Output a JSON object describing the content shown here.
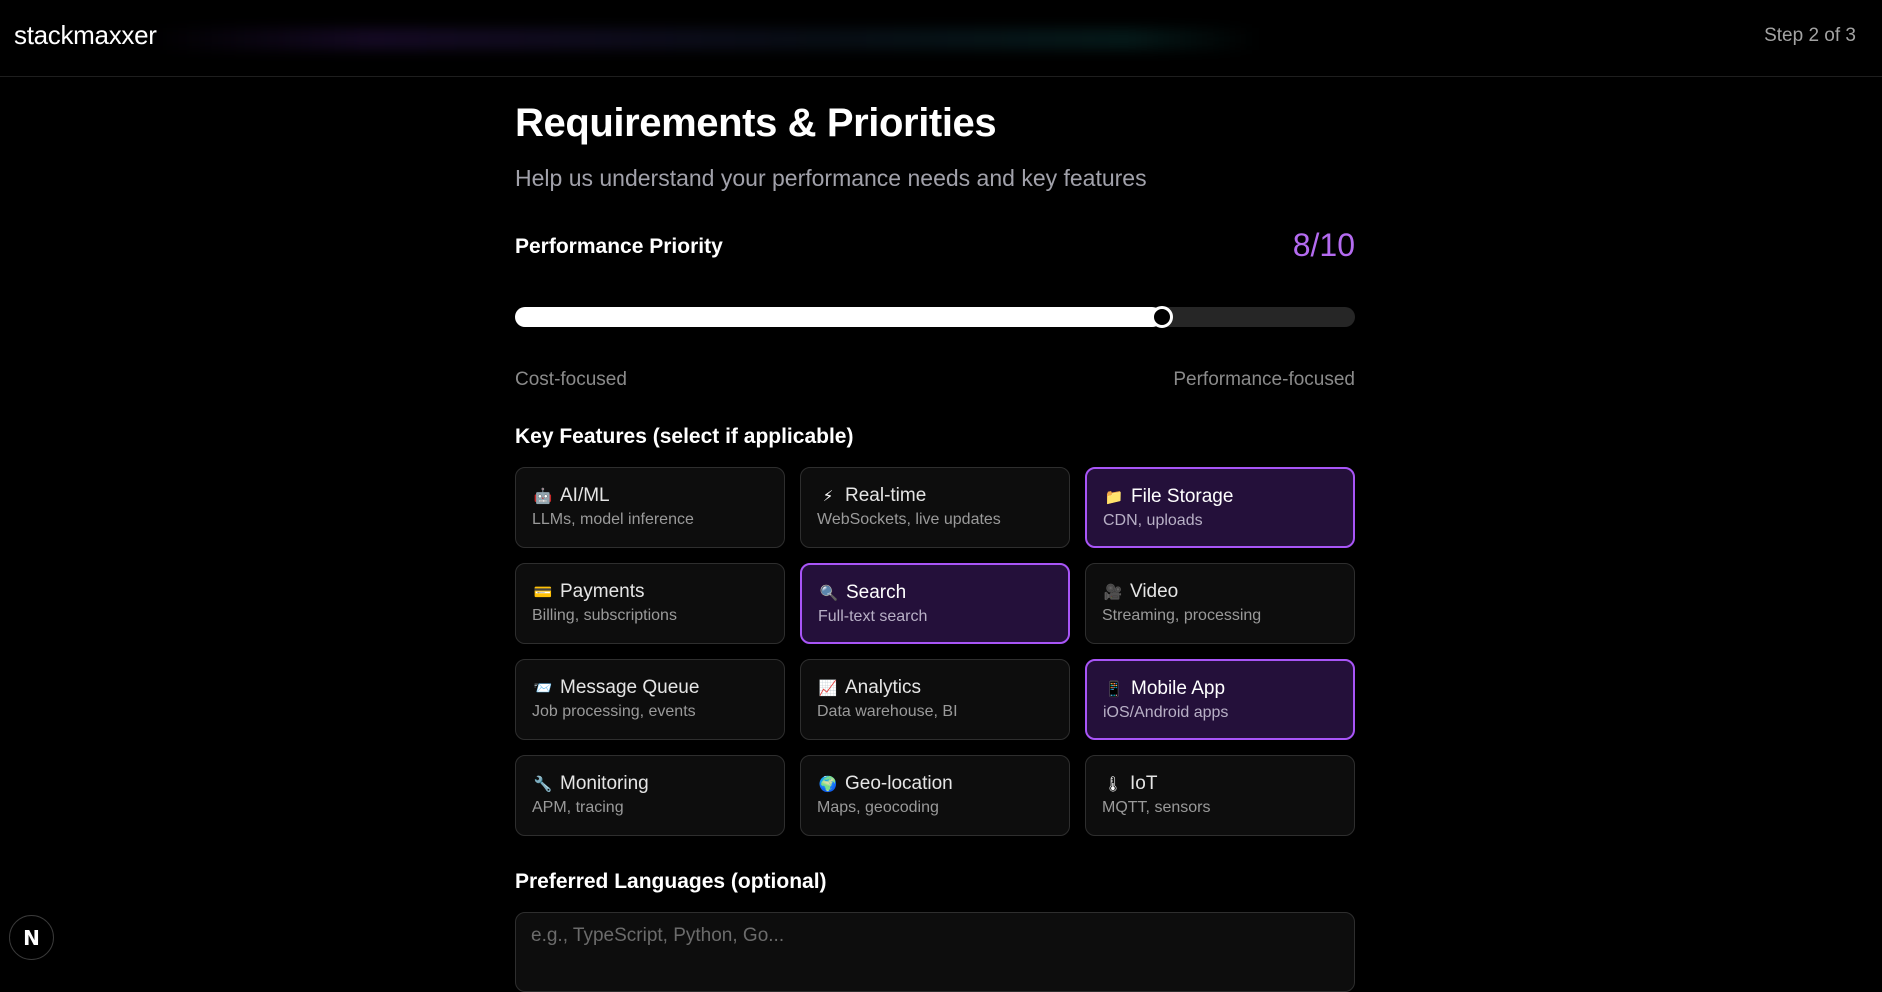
{
  "header": {
    "brand": "stackmaxxer",
    "step": "Step 2 of 3"
  },
  "page": {
    "title": "Requirements & Priorities",
    "subtitle": "Help us understand your performance needs and key features"
  },
  "performance": {
    "label": "Performance Priority",
    "value_text": "8/10",
    "value": 8,
    "max": 10,
    "fill_fraction": 0.77,
    "min_label": "Cost-focused",
    "max_label": "Performance-focused"
  },
  "features": {
    "label": "Key Features (select if applicable)",
    "items": [
      {
        "icon": "robot-icon",
        "glyph": "🤖",
        "title": "AI/ML",
        "desc": "LLMs, model inference",
        "selected": false
      },
      {
        "icon": "lightning-icon",
        "glyph": "⚡",
        "title": "Real-time",
        "desc": "WebSockets, live updates",
        "selected": false
      },
      {
        "icon": "folder-icon",
        "glyph": "📁",
        "title": "File Storage",
        "desc": "CDN, uploads",
        "selected": true
      },
      {
        "icon": "credit-card-icon",
        "glyph": "💳",
        "title": "Payments",
        "desc": "Billing, subscriptions",
        "selected": false
      },
      {
        "icon": "magnifier-icon",
        "glyph": "🔍",
        "title": "Search",
        "desc": "Full-text search",
        "selected": true
      },
      {
        "icon": "video-camera-icon",
        "glyph": "🎥",
        "title": "Video",
        "desc": "Streaming, processing",
        "selected": false
      },
      {
        "icon": "mailbox-icon",
        "glyph": "📨",
        "title": "Message Queue",
        "desc": "Job processing, events",
        "selected": false
      },
      {
        "icon": "chart-icon",
        "glyph": "📈",
        "title": "Analytics",
        "desc": "Data warehouse, BI",
        "selected": false
      },
      {
        "icon": "phone-icon",
        "glyph": "📱",
        "title": "Mobile App",
        "desc": "iOS/Android apps",
        "selected": true
      },
      {
        "icon": "wrench-icon",
        "glyph": "🔧",
        "title": "Monitoring",
        "desc": "APM, tracing",
        "selected": false
      },
      {
        "icon": "globe-icon",
        "glyph": "🌍",
        "title": "Geo-location",
        "desc": "Maps, geocoding",
        "selected": false
      },
      {
        "icon": "thermometer-icon",
        "glyph": "🌡",
        "title": "IoT",
        "desc": "MQTT, sensors",
        "selected": false
      }
    ]
  },
  "languages": {
    "label": "Preferred Languages (optional)",
    "value": "",
    "placeholder": "e.g., TypeScript, Python, Go..."
  },
  "dev_badge": {
    "glyph": "N",
    "icon": "nextjs-logo-icon"
  },
  "colors": {
    "accent": "#a855f7",
    "accent_text": "#b46bf0",
    "selected_bg": "#24103a",
    "background": "#000000"
  }
}
